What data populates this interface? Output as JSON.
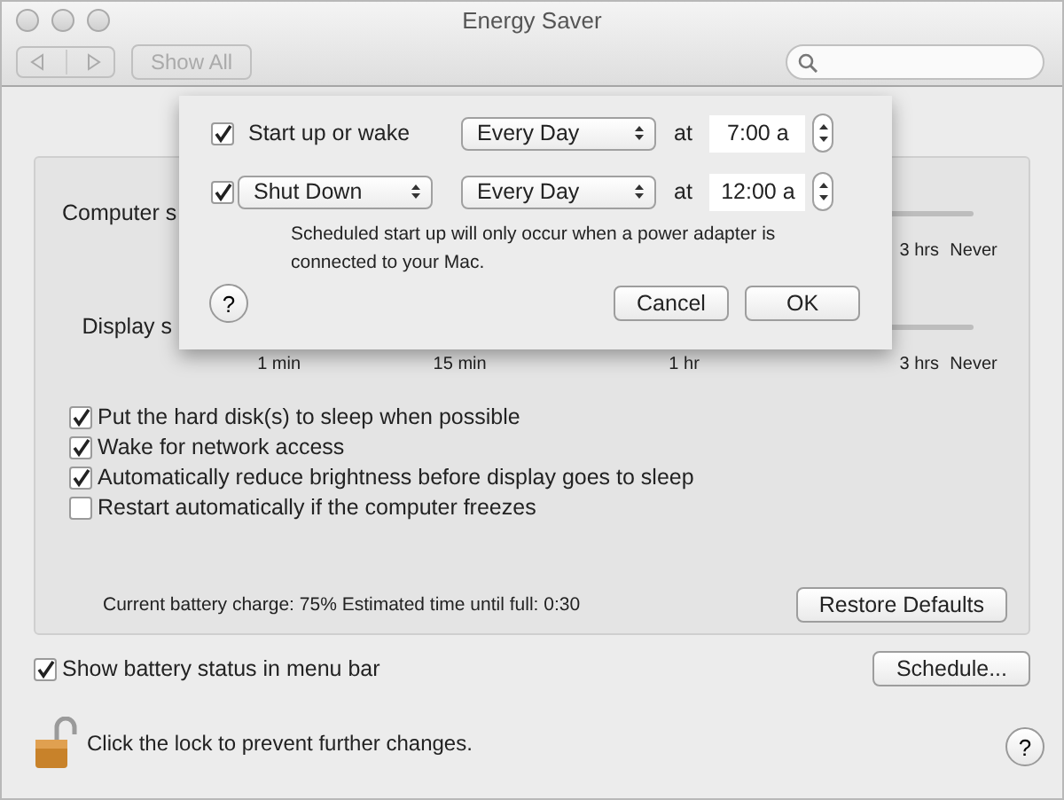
{
  "window": {
    "title": "Energy Saver"
  },
  "toolbar": {
    "show_all": "Show All"
  },
  "sliders": [
    {
      "label": "Computer s",
      "ticks": [
        "3 hrs",
        "Never"
      ]
    },
    {
      "label": "Display s",
      "ticks": [
        "1 min",
        "15 min",
        "1 hr",
        "3 hrs",
        "Never"
      ]
    }
  ],
  "options": [
    {
      "label": "Put the hard disk(s) to sleep when possible",
      "checked": true
    },
    {
      "label": "Wake for network access",
      "checked": true
    },
    {
      "label": "Automatically reduce brightness before display goes to sleep",
      "checked": true
    },
    {
      "label": "Restart automatically if the computer freezes",
      "checked": false
    }
  ],
  "battery_status": "Current battery charge: 75%  Estimated time until full: 0:30",
  "restore_defaults": "Restore Defaults",
  "show_battery": {
    "label": "Show battery status in menu bar",
    "checked": true
  },
  "schedule_button": "Schedule...",
  "lock_text": "Click the lock to prevent further changes.",
  "help": "?",
  "sheet": {
    "rows": [
      {
        "kind": "label",
        "checked": true,
        "action": "Start up or wake",
        "repeat": "Every Day",
        "at": "at",
        "time": "7:00 a"
      },
      {
        "kind": "popup",
        "checked": true,
        "action": "Shut Down",
        "repeat": "Every Day",
        "at": "at",
        "time": "12:00 a"
      }
    ],
    "note": "Scheduled start up will only occur when a power adapter is connected to your Mac.",
    "help": "?",
    "cancel": "Cancel",
    "ok": "OK"
  }
}
